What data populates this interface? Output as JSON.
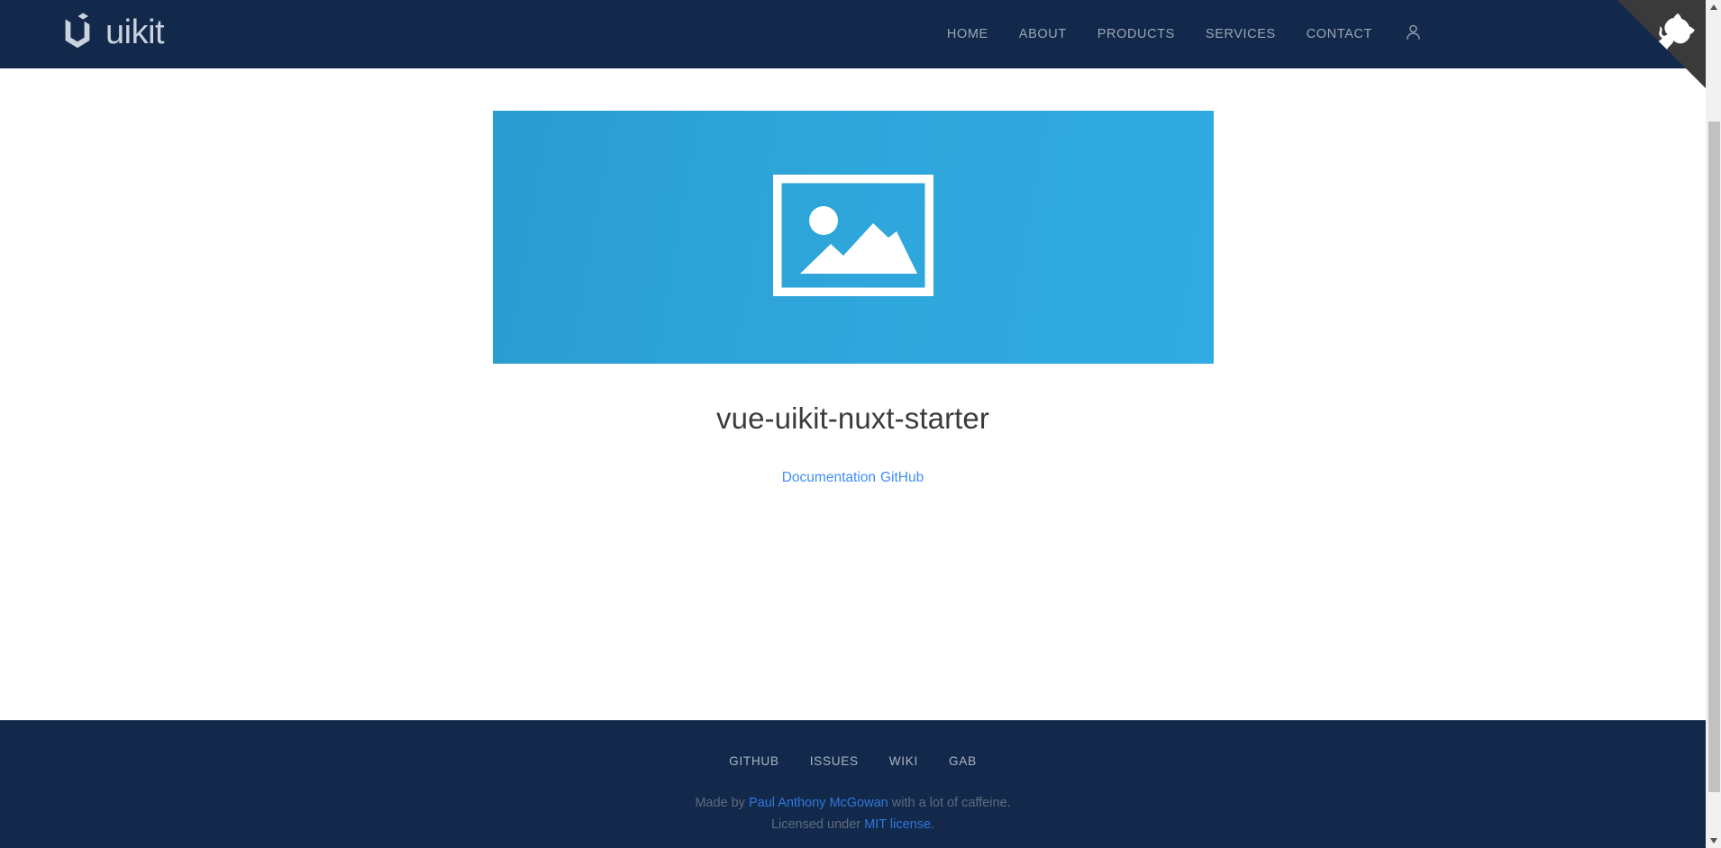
{
  "header": {
    "brand": {
      "logo_icon": "uikit-hexagon-logo-icon",
      "text": "uikit"
    },
    "nav_items": [
      {
        "label": "HOME"
      },
      {
        "label": "ABOUT"
      },
      {
        "label": "PRODUCTS"
      },
      {
        "label": "SERVICES"
      },
      {
        "label": "CONTACT"
      }
    ],
    "account_icon": "user-account-icon",
    "github_corner_icon": "github-octocat-corner-icon",
    "background_color": "#13294B",
    "link_color": "#9AA5B4"
  },
  "main": {
    "hero_image": {
      "placeholder_icon": "image-placeholder-icon",
      "gradient_from": "#2A9CCF",
      "gradient_to": "#31ABE2"
    },
    "title": "vue-uikit-nuxt-starter",
    "links": [
      {
        "label": "Documentation"
      },
      {
        "label": "GitHub"
      }
    ],
    "link_color": "#3E8EF7",
    "background_color": "#FFFFFF"
  },
  "footer": {
    "nav_items": [
      {
        "label": "GITHUB"
      },
      {
        "label": "ISSUES"
      },
      {
        "label": "WIKI"
      },
      {
        "label": "GAB"
      }
    ],
    "credit_line": {
      "prefix": "Made by ",
      "author": "Paul Anthony McGowan",
      "suffix": " with a lot of caffeine."
    },
    "license_line": {
      "prefix": "Licensed under ",
      "license": "MIT license",
      "suffix": "."
    },
    "background_color": "#13294B",
    "text_color": "#5E6B7E",
    "link_color": "#2F77DB"
  },
  "scrollbar": {
    "up_arrow_icon": "scroll-up-arrow-icon",
    "down_arrow_icon": "scroll-down-arrow-icon",
    "thumb_icon": "scrollbar-thumb"
  }
}
